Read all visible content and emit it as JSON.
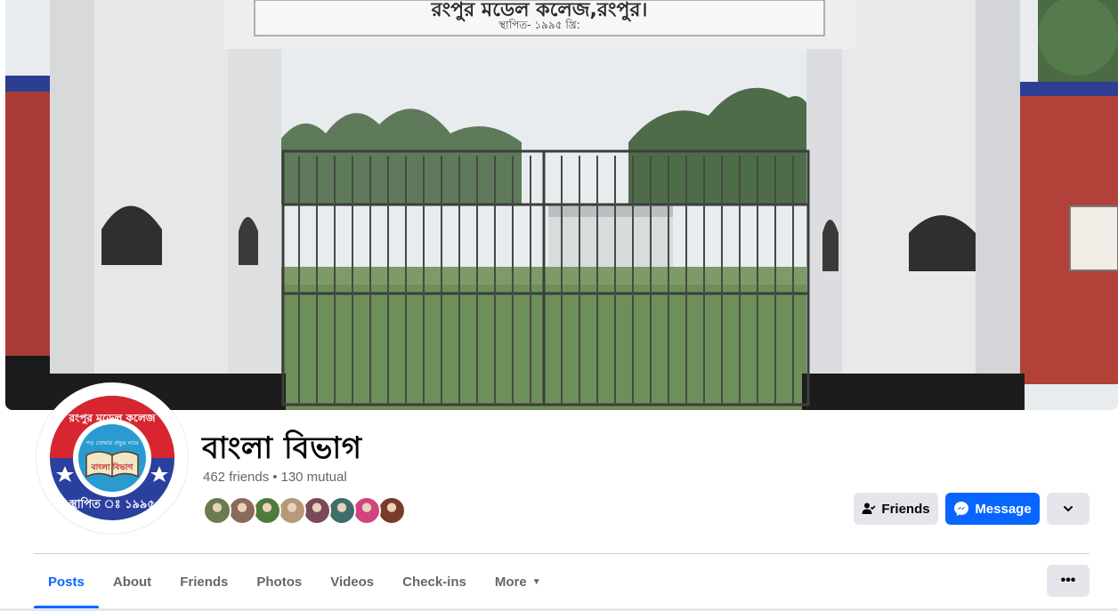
{
  "cover": {
    "sign_line1": "রংপুর মডেল কলেজ,রংপুর।",
    "sign_line2": "স্থাপিত- ১৯৯৫ খ্রি:"
  },
  "avatar": {
    "ring_text_top": "রংপুর মডেল কলেজ",
    "ring_text_bottom": "স্থাপিত ঃ ১৯৯৫",
    "inner_text": "পড় তোমার প্রভুর নামে",
    "center_text": "বাংলা বিভাগ"
  },
  "profile": {
    "name": "বাংলা বিভাগ",
    "friends_count": "462 friends",
    "separator": "•",
    "mutual_count": "130 mutual"
  },
  "mutual_friend_avatars": [
    {
      "icon": "friend-photo",
      "color": "#6b7a4f"
    },
    {
      "icon": "friend-photo",
      "color": "#8c6a58"
    },
    {
      "icon": "friend-photo",
      "color": "#4f7a3c"
    },
    {
      "icon": "friend-photo",
      "color": "#b59a7a"
    },
    {
      "icon": "friend-photo",
      "color": "#7a4a5a"
    },
    {
      "icon": "friend-photo",
      "color": "#3f6d6a"
    },
    {
      "icon": "friend-photo",
      "color": "#d2447f"
    },
    {
      "icon": "friend-photo",
      "color": "#7a3a2a"
    }
  ],
  "actions": {
    "friends_label": "Friends",
    "message_label": "Message"
  },
  "tabs": [
    {
      "label": "Posts",
      "active": true
    },
    {
      "label": "About",
      "active": false
    },
    {
      "label": "Friends",
      "active": false
    },
    {
      "label": "Photos",
      "active": false
    },
    {
      "label": "Videos",
      "active": false
    },
    {
      "label": "Check-ins",
      "active": false
    },
    {
      "label": "More",
      "active": false
    }
  ],
  "colors": {
    "accent": "#0866ff",
    "secondary_text": "#65676b",
    "button_gray": "#e4e6eb"
  }
}
